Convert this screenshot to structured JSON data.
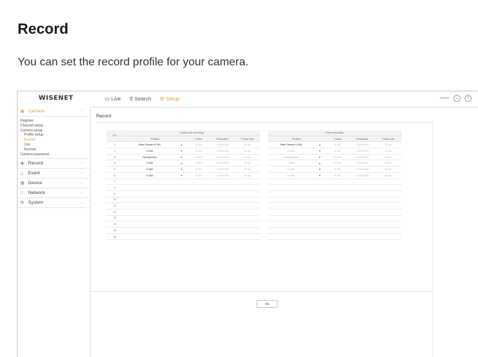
{
  "doc": {
    "title": "Record",
    "description": "You can set the record profile for your camera."
  },
  "app": {
    "logo": "WISENET",
    "nav": [
      {
        "label": "Live",
        "icon": "monitor-icon",
        "active": false
      },
      {
        "label": "Search",
        "icon": "search-icon",
        "active": false
      },
      {
        "label": "Setup",
        "icon": "gear-icon",
        "active": true
      }
    ],
    "user": "admin",
    "accent": "#e8a23a"
  },
  "sidebar": {
    "camera": {
      "label": "Camera",
      "subitems": [
        {
          "label": "Register"
        },
        {
          "label": "Channel setup"
        },
        {
          "label": "Camera setup"
        },
        {
          "label": "Profile setup"
        },
        {
          "label": "Record"
        },
        {
          "label": "Live"
        },
        {
          "label": "Remote"
        },
        {
          "label": "Camera password"
        }
      ]
    },
    "sections": [
      {
        "label": "Record",
        "icon": "record-icon"
      },
      {
        "label": "Event",
        "icon": "event-icon"
      },
      {
        "label": "Device",
        "icon": "device-icon"
      },
      {
        "label": "Network",
        "icon": "network-icon"
      },
      {
        "label": "System",
        "icon": "system-icon"
      }
    ]
  },
  "content": {
    "title": "Record",
    "ok_label": "Ok",
    "table": {
      "ch_header": "CH",
      "group_continuous": "Continuous recording",
      "group_event": "Event recording",
      "columns_continuous": [
        "Profiles",
        "Codec",
        "Resolution",
        "Frame rate"
      ],
      "columns_event": [
        "Profiles",
        "Codec",
        "Resolution",
        "Frame rate"
      ],
      "rows": [
        {
          "ch": "1",
          "cont_profile": "Main Stream H.264",
          "cont_codec": "H.264",
          "cont_res": "1920x1080",
          "cont_fps": "30 fps",
          "evt_profile": "Main Stream H.264",
          "evt_codec": "H.264",
          "evt_res": "1920x1080",
          "evt_fps": "30 fps"
        },
        {
          "ch": "2",
          "cont_profile": "H.264",
          "cont_codec": "H.264",
          "cont_res": "1920x1080",
          "cont_fps": "30 fps",
          "evt_profile": "H.264",
          "evt_codec": "H.264",
          "evt_res": "1920x1080",
          "evt_fps": "30 fps"
        },
        {
          "ch": "3",
          "cont_profile": "FisheyeView",
          "cont_codec": "H.264",
          "cont_res": "2048x2048",
          "cont_fps": "15 fps",
          "evt_profile": "FisheyeView",
          "evt_codec": "H.264",
          "evt_res": "2048x2048",
          "evt_fps": "15 fps"
        },
        {
          "ch": "4",
          "cont_profile": "H.264",
          "cont_codec": "H.264",
          "cont_res": "1920x1080",
          "cont_fps": "30 fps",
          "evt_profile": "H.264",
          "evt_codec": "H.264",
          "evt_res": "1920x1080",
          "evt_fps": "30 fps"
        },
        {
          "ch": "5",
          "cont_profile": "H.264",
          "cont_codec": "H.264",
          "cont_res": "1920x1080",
          "cont_fps": "30 fps",
          "evt_profile": "H.264",
          "evt_codec": "H.264",
          "evt_res": "1920x1080",
          "evt_fps": "30 fps"
        },
        {
          "ch": "6",
          "cont_profile": "H.264",
          "cont_codec": "H.264",
          "cont_res": "1920x1080",
          "cont_fps": "30 fps",
          "evt_profile": "H.264",
          "evt_codec": "H.264",
          "evt_res": "1920x1080",
          "evt_fps": "30 fps"
        },
        {
          "ch": "7"
        },
        {
          "ch": "8"
        },
        {
          "ch": "9"
        },
        {
          "ch": "10"
        },
        {
          "ch": "11"
        },
        {
          "ch": "12"
        },
        {
          "ch": "13"
        },
        {
          "ch": "14"
        },
        {
          "ch": "15"
        },
        {
          "ch": "16"
        }
      ]
    }
  }
}
